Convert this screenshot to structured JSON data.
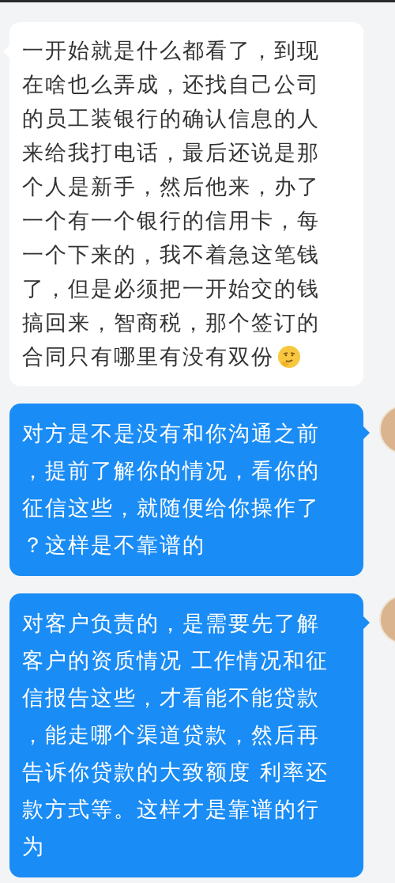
{
  "messages": [
    {
      "kind": "received",
      "text": "一开始就是什么都看了，到现在啥也么弄成，还找自己公司的员工装银行的确认信息的人来给我打电话，最后还说是那个人是新手，然后他来，办了一个有一个银行的信用卡，每一个下来的，我不着急这笔钱了，但是必须把一开始交的钱搞回来，智商税，那个签订的合同只有哪里有没有双份",
      "emoji": true
    },
    {
      "kind": "sent",
      "text": "对方是不是没有和你沟通之前，提前了解你的情况，看你的征信这些，就随便给你操作了？这样是不靠谱的",
      "emoji": false
    },
    {
      "kind": "sent",
      "text": "对客户负责的，是需要先了解客户的资质情况 工作情况和征信报告这些，才看能不能贷款，能走哪个渠道贷款，然后再告诉你贷款的大致额度 利率还款方式等。这样才是靠谱的行为",
      "emoji": false
    }
  ]
}
